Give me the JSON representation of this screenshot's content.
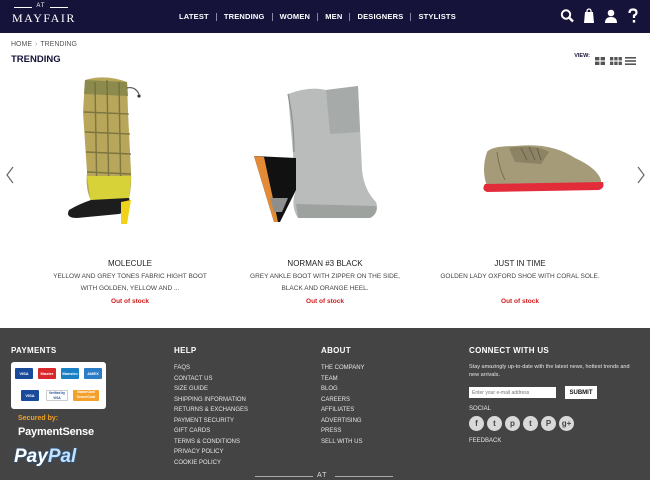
{
  "header": {
    "logo_at": "AT",
    "logo_name": "MAYFAIR",
    "nav": [
      "LATEST",
      "TRENDING",
      "WOMEN",
      "MEN",
      "DESIGNERS",
      "STYLISTS"
    ],
    "icons": [
      "search-icon",
      "bag-icon",
      "user-icon",
      "help-icon"
    ]
  },
  "breadcrumb": {
    "home": "HOME",
    "separator": "›",
    "current": "TRENDING"
  },
  "page_title": "TRENDING",
  "view_label": "VIEW:",
  "products": [
    {
      "name": "MOLECULE",
      "description": "YELLOW AND GREY TONES FABRIC HIGHT BOOT WITH GOLDEN, YELLOW AND ...",
      "stock": "Out of stock"
    },
    {
      "name": "NORMAN #3 BLACK",
      "description": "GREY ANKLE BOOT WITH ZIPPER ON THE SIDE, BLACK AND ORANGE HEEL.",
      "stock": "Out of stock"
    },
    {
      "name": "JUST IN TIME",
      "description": "GOLDEN LADY OXFORD SHOE WITH CORAL SOLE.",
      "stock": "Out of stock"
    }
  ],
  "footer": {
    "payments": {
      "title": "PAYMENTS",
      "cards": [
        "VISA",
        "Master",
        "Maestro",
        "AMEX",
        "VISA",
        "Verified by VISA",
        "MasterCard SecureCode"
      ],
      "secured_by": "Secured by:",
      "paymentsense": "PaymentSense",
      "paypal_a": "Pay",
      "paypal_b": "Pal"
    },
    "help": {
      "title": "HELP",
      "links": [
        "FAQS",
        "CONTACT US",
        "SIZE GUIDE",
        "SHIPPING INFORMATION",
        "RETURNS & EXCHANGES",
        "PAYMENT SECURITY",
        "GIFT CARDS",
        "TERMS & CONDITIONS",
        "PRIVACY POLICY",
        "COOKIE POLICY"
      ]
    },
    "about": {
      "title": "ABOUT",
      "links": [
        "THE COMPANY",
        "TEAM",
        "BLOG",
        "CAREERS",
        "AFFILIATES",
        "ADVERTISING",
        "PRESS",
        "SELL WITH US"
      ]
    },
    "connect": {
      "title": "CONNECT WITH US",
      "text": "Stay amazingly up-to-date with the latest news, hottest trends and new arrivals.",
      "email_placeholder": "Enter your e-mail address",
      "submit": "SUBMIT",
      "social_label": "SOCIAL",
      "social": [
        "f",
        "t",
        "p",
        "t",
        "P",
        "g+"
      ],
      "feedback": "FEEDBACK"
    },
    "bottom_logo": "AT"
  }
}
